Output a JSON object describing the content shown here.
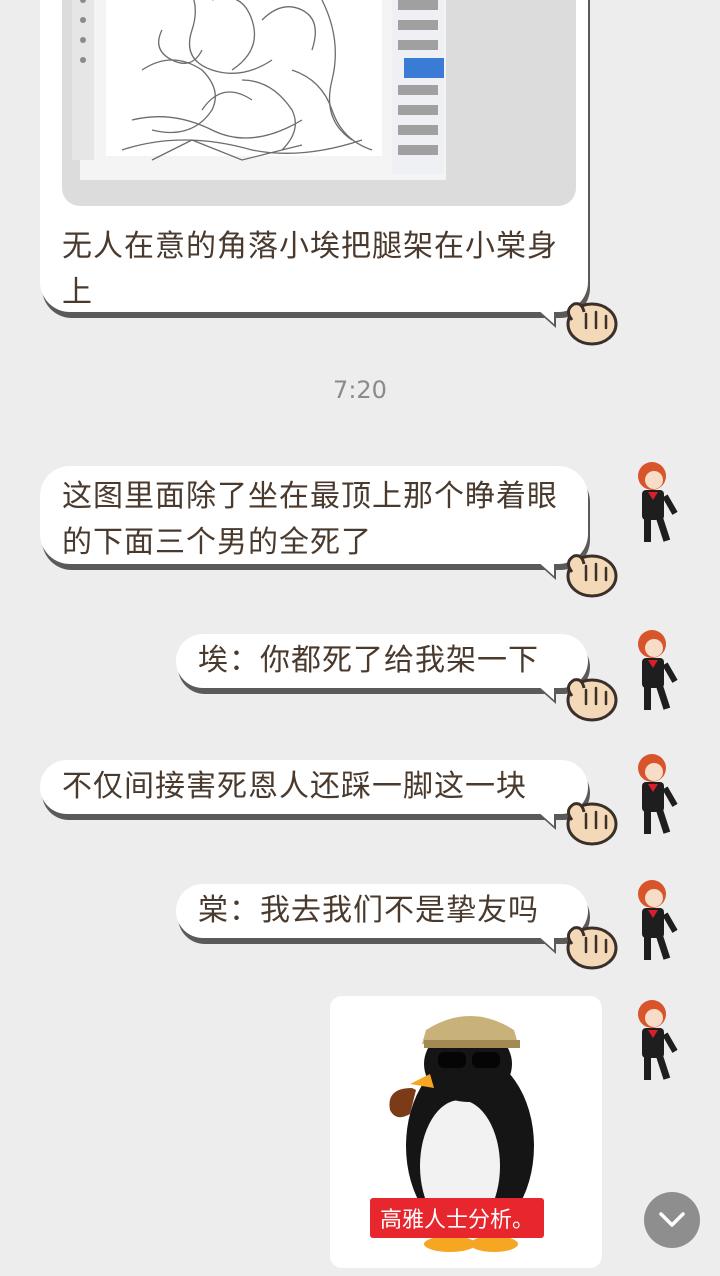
{
  "messages": [
    {
      "text": "无人在意的角落小埃把腿架在小棠身上"
    },
    {
      "text": "这图里面除了坐在最顶上那个睁着眼的下面三个男的全死了"
    },
    {
      "text": "埃：你都死了给我架一下"
    },
    {
      "text": "不仅间接害死恩人还踩一脚这一块"
    },
    {
      "text": "棠：我去我们不是挚友吗"
    }
  ],
  "timestamp": "7:20",
  "sticker": {
    "caption": "高雅人士分析。"
  },
  "icons": {
    "paw": "paw-hand-icon",
    "scroll": "chevron-down-icon",
    "avatar": "character-avatar"
  },
  "colors": {
    "background": "#ededed",
    "bubble": "#ffffff",
    "text": "#4a3a2e",
    "shadow": "#5c5a58",
    "sticker_caption_bg": "#e8262d"
  }
}
